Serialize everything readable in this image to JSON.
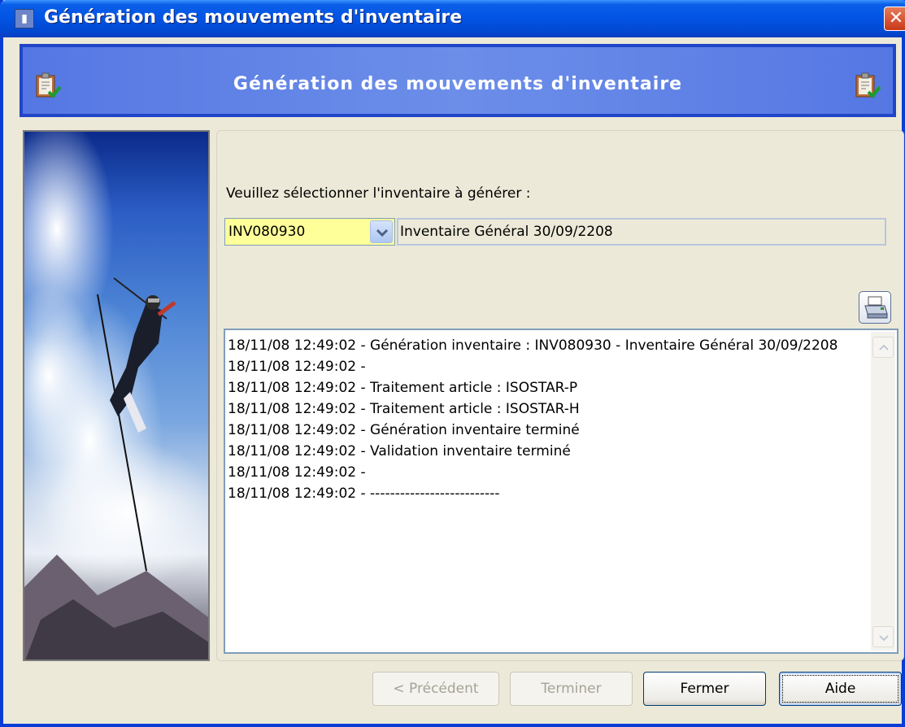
{
  "window": {
    "title": "Génération des mouvements d'inventaire",
    "close_label": "✕"
  },
  "banner": {
    "title": "Génération des mouvements d'inventaire"
  },
  "form": {
    "prompt": "Veuillez sélectionner l'inventaire à générer :",
    "inventory_code": "INV080930",
    "inventory_description": "Inventaire Général 30/09/2208"
  },
  "log": {
    "lines": [
      "18/11/08 12:49:02 - Génération inventaire : INV080930 - Inventaire Général 30/09/2208",
      "18/11/08 12:49:02 - ",
      "18/11/08 12:49:02 - Traitement article : ISOSTAR-P",
      "18/11/08 12:49:02 - Traitement article : ISOSTAR-H",
      "18/11/08 12:49:02 - Génération inventaire terminé",
      "18/11/08 12:49:02 - Validation inventaire terminé",
      "18/11/08 12:49:02 - ",
      "18/11/08 12:49:02 - --------------------------"
    ]
  },
  "buttons": {
    "previous": "< Précédent",
    "finish": "Terminer",
    "close": "Fermer",
    "help": "Aide"
  },
  "colors": {
    "titlebar": "#0355e5",
    "banner": "#5577e3",
    "combo_bg": "#ffff99"
  }
}
